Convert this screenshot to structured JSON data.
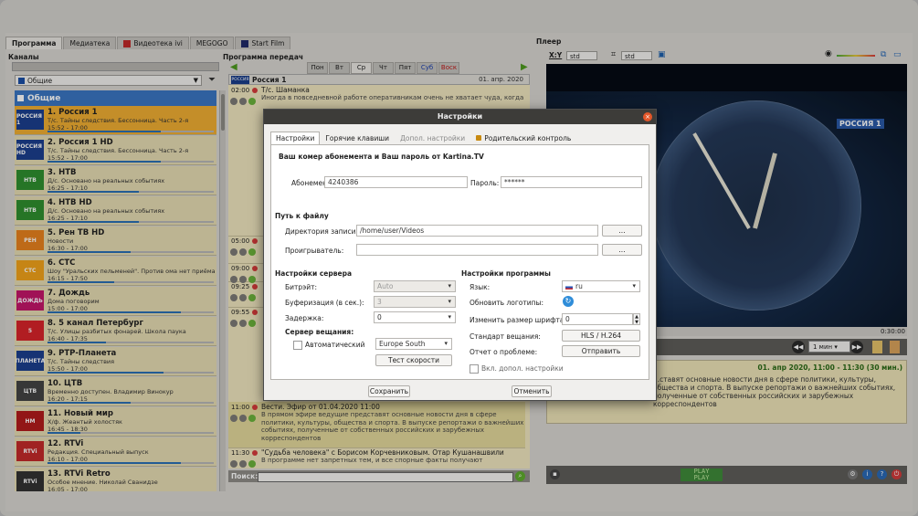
{
  "app": {
    "tabs": [
      {
        "label": "Программа",
        "active": true
      },
      {
        "label": "Медиатека"
      },
      {
        "label": "Видеотека ivi"
      },
      {
        "label": "MEGOGO"
      },
      {
        "label": "Start Film"
      }
    ],
    "sections": {
      "channels": "Каналы",
      "program": "Программа передач",
      "player": "Плеер"
    }
  },
  "channels": {
    "filter_value": "Общие",
    "group": "Общие",
    "items": [
      {
        "name": "1. Россия 1",
        "show": "Т/с. Тайны следствия. Бессонница. Часть 2-я",
        "time": "15:52 - 17:00",
        "progress": 0.68,
        "selected": true,
        "logo": "РОССИЯ 1",
        "logo_color": "#1c3f8e"
      },
      {
        "name": "2. Россия 1 HD",
        "show": "Т/с. Тайны следствия. Бессонница. Часть 2-я",
        "time": "15:52 - 17:00",
        "progress": 0.68,
        "logo": "РОССИЯ HD",
        "logo_color": "#1c3f8e"
      },
      {
        "name": "3. НТВ",
        "show": "Д/с. Основано на реальных событиях",
        "time": "16:25 - 17:10",
        "progress": 0.55,
        "logo": "НТВ",
        "logo_color": "#2f8f2f"
      },
      {
        "name": "4. НТВ HD",
        "show": "Д/с. Основано на реальных событиях",
        "time": "16:25 - 17:10",
        "progress": 0.55,
        "logo": "НТВ",
        "logo_color": "#2f8f2f"
      },
      {
        "name": "5. Рен ТВ HD",
        "show": "Новости",
        "time": "16:30 - 17:00",
        "progress": 0.5,
        "logo": "РЕН",
        "logo_color": "#e8821e"
      },
      {
        "name": "6. СТС",
        "show": "Шоу \"Уральских пельменей\". Против ома нет приёма",
        "time": "16:15 - 17:50",
        "progress": 0.4,
        "logo": "СТС",
        "logo_color": "#f2a31a"
      },
      {
        "name": "7. Дождь",
        "show": "Дома поговорим",
        "time": "15:00 - 17:00",
        "progress": 0.8,
        "logo": "ДОЖДЬ",
        "logo_color": "#c4166a"
      },
      {
        "name": "8. 5 канал Петербург",
        "show": "Т/с. Улицы разбитых фонарей. Школа паука",
        "time": "16:40 - 17:35",
        "progress": 0.35,
        "logo": "5",
        "logo_color": "#d8242a"
      },
      {
        "name": "9. РТР-Планета",
        "show": "Т/с. Тайны следствия",
        "time": "15:50 - 17:00",
        "progress": 0.7,
        "logo": "ПЛАНЕТА",
        "logo_color": "#1c3f8e"
      },
      {
        "name": "10. ЦТВ",
        "show": "Временно доступен. Владимир Винокур",
        "time": "16:20 - 17:15",
        "progress": 0.5,
        "logo": "ЦТВ",
        "logo_color": "#444444"
      },
      {
        "name": "11. Новый мир",
        "show": "Х/ф. Жеантый холостяк",
        "time": "16:45 - 18:30",
        "progress": 0.2,
        "logo": "НМ",
        "logo_color": "#b31b1b"
      },
      {
        "name": "12. RTVi",
        "show": "Редакция. Специальный выпуск",
        "time": "16:10 - 17:00",
        "progress": 0.8,
        "logo": "RTVi",
        "logo_color": "#c42a2a"
      },
      {
        "name": "13. RTVi Retro",
        "show": "Особое мнение. Николай Сванидзе",
        "time": "16:05 - 17:00",
        "progress": 0.75,
        "logo": "RTVi",
        "logo_color": "#333333"
      }
    ]
  },
  "program": {
    "nav_prev": "◀",
    "nav_next": "▶",
    "days": [
      {
        "label": "Пон"
      },
      {
        "label": "Вт"
      },
      {
        "label": "Ср",
        "current": true
      },
      {
        "label": "Чт"
      },
      {
        "label": "Пят"
      },
      {
        "label": "Суб",
        "kind": "sat"
      },
      {
        "label": "Воск",
        "kind": "sun"
      }
    ],
    "channel_logo": "РОССИЯ 1",
    "channel": "Россия 1",
    "date": "01. апр. 2020",
    "items": [
      {
        "time": "02:00",
        "title": "Т/с. Шаманка",
        "desc": "Иногда в повседневной работе оперативникам очень не хватает чуда, когда"
      },
      {
        "time": "05:00",
        "title": "",
        "desc": ""
      },
      {
        "time": "09:00",
        "title": "",
        "desc": ""
      },
      {
        "time": "09:25",
        "title": "",
        "desc": ""
      },
      {
        "time": "09:55",
        "title": "",
        "desc": ""
      },
      {
        "time": "11:00",
        "title": "Вести. Эфир от 01.04.2020 11:00",
        "desc": "В прямом эфире ведущие представят основные новости дня в сфере политики, культуры, общества и спорта. В выпуске репортажи о важнейших событиях, полученные от собственных российских и зарубежных корреспондентов"
      },
      {
        "time": "11:30",
        "title": "\"Судьба человека\" с Борисом Корчевниковым. Отар Кушанашвили",
        "desc": "В программе нет запретных тем, и все спорные факты получают"
      }
    ],
    "search_label": "Поиск:",
    "search_value": ""
  },
  "player": {
    "aspect_label": "X:Y",
    "aspect_value": "std",
    "crop_value": "std",
    "tv_logo": "РОССИЯ 1",
    "duration": "0:30:00",
    "interval": "1 мин",
    "info_date": "01. апр 2020, 11:00 - 11:30 (30 мин.)",
    "info_desc": "...ставят основные новости дня в сфере политики, культуры, общества и спорта. В выпуске репортажи о важнейших событиях, полученные от собственных российских и зарубежных корреспондентов",
    "lcd_top": "PLAY",
    "lcd_bottom": "PLAY"
  },
  "dialog": {
    "title": "Настройки",
    "close": "×",
    "tabs": [
      {
        "label": "Настройки",
        "active": true
      },
      {
        "label": "Горячие клавиши"
      },
      {
        "label": "Допол. настройки",
        "disabled": true
      },
      {
        "label": "Родительский контроль",
        "lock": true
      }
    ],
    "account_heading": "Ваш комер абонемента и Ваш пароль от Kartina.TV",
    "subscription_label": "Абонемент:",
    "subscription_value": "4240386",
    "password_label": "Пароль:",
    "password_value": "******",
    "path_heading": "Путь к файлу",
    "rec_dir_label": "Директория записи:",
    "rec_dir_value": "/home/user/Videos",
    "player_label": "Проигрыватель:",
    "player_value": "",
    "browse": "...",
    "server_heading": "Настройки сервера",
    "bitrate_label": "Битрэйт:",
    "bitrate_value": "Auto",
    "buffer_label": "Буферизация (в сек.):",
    "buffer_value": "3",
    "delay_label": "Задержка:",
    "delay_value": "0",
    "broadcast_heading": "Сервер вещания:",
    "auto_label": "Автоматический",
    "server_value": "Europe South",
    "speedtest": "Тест скорости",
    "program_heading": "Настройки программы",
    "language_label": "Язык:",
    "language_value": "ru",
    "logos_label": "Обновить логотипы:",
    "font_label": "Изменить размер шрифта:",
    "font_value": "0",
    "standard_label": "Стандарт вещания:",
    "standard_value": "HLS / H.264",
    "report_label": "Отчет о проблеме:",
    "report_button": "Отправить",
    "extra_label": "Вкл. допол. настройки",
    "save": "Сохранить",
    "cancel": "Отменить"
  }
}
